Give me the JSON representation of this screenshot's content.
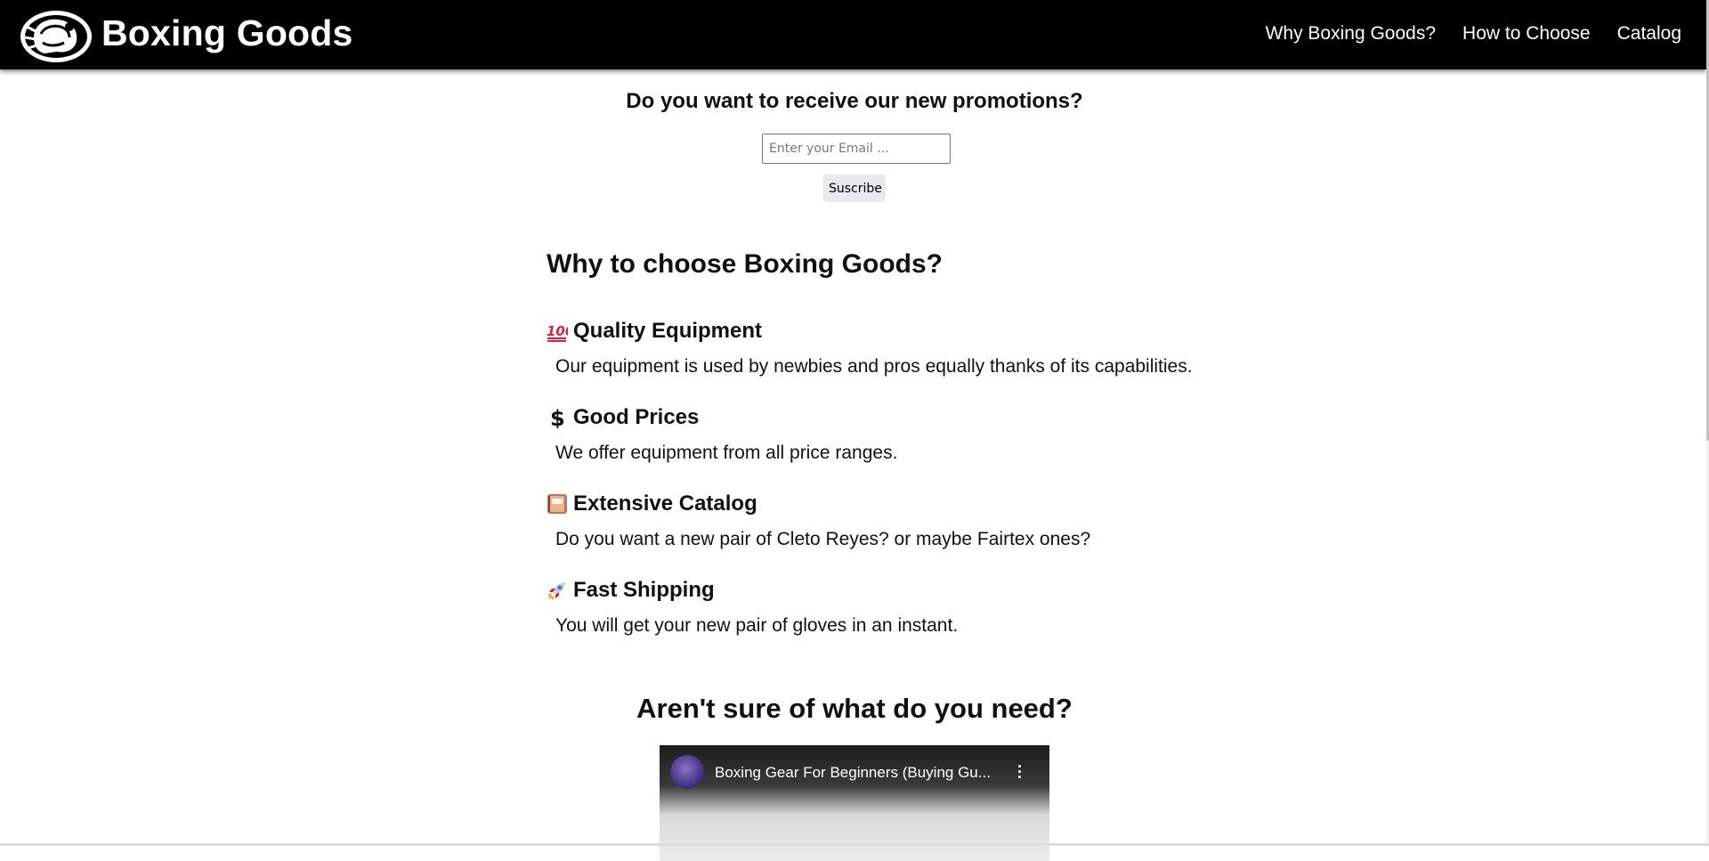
{
  "header": {
    "brand": "Boxing Goods",
    "logo_icon": "boxing-glove-logo-icon",
    "nav": [
      {
        "label": "Why Boxing Goods?"
      },
      {
        "label": "How to Choose"
      },
      {
        "label": "Catalog"
      }
    ]
  },
  "promo": {
    "title": "Do you want to receive our new promotions?",
    "email_placeholder": "Enter your Email ...",
    "email_value": "",
    "subscribe_label": "Suscribe"
  },
  "why": {
    "title": "Why to choose Boxing Goods?",
    "features": [
      {
        "icon": "hundred-points-icon",
        "title": "Quality Equipment",
        "desc": "Our equipment is used by newbies and pros equally thanks of its capabilities."
      },
      {
        "icon": "dollar-sign-icon",
        "title": "Good Prices",
        "desc": "We offer equipment from all price ranges."
      },
      {
        "icon": "book-icon",
        "title": "Extensive Catalog",
        "desc": "Do you want a new pair of Cleto Reyes? or maybe Fairtex ones?"
      },
      {
        "icon": "rocket-icon",
        "title": "Fast Shipping",
        "desc": "You will get your new pair of gloves in an instant."
      }
    ]
  },
  "help": {
    "title": "Aren't sure of what do you need?",
    "video_title": "Boxing Gear For Beginners (Buying Gu..."
  },
  "colors": {
    "header_bg": "#000000",
    "header_text": "#ffffff",
    "hundred_red": "#d8223c",
    "book_brown": "#b9785a"
  }
}
